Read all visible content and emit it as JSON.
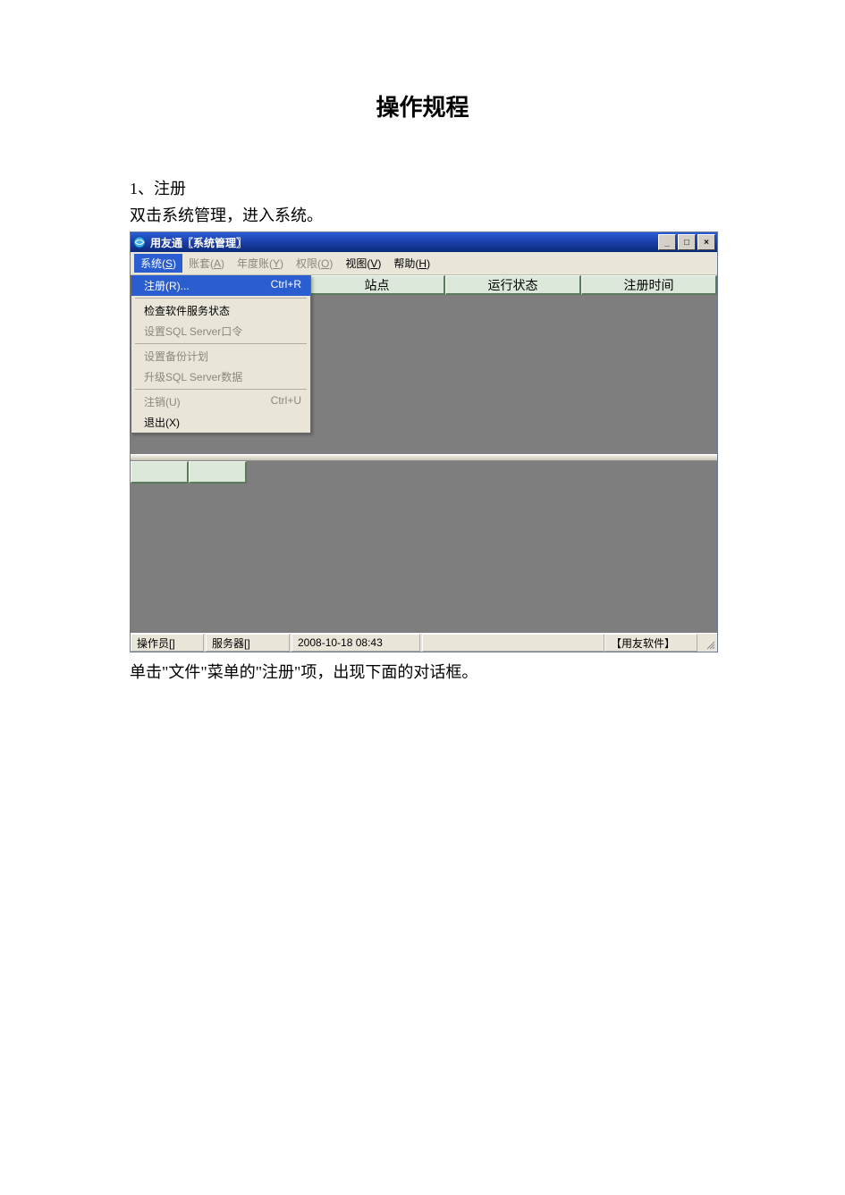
{
  "document": {
    "title": "操作规程",
    "section_number": "1、注册",
    "section_instruction": "双击系统管理，进入系统。",
    "caption_after": "单击\"文件\"菜单的\"注册\"项，出现下面的对话框。"
  },
  "window": {
    "title": "用友通〖系统管理〗",
    "menubar": [
      {
        "label": "系统",
        "mnemonic": "S",
        "disabled": false,
        "open": true
      },
      {
        "label": "账套",
        "mnemonic": "A",
        "disabled": true
      },
      {
        "label": "年度账",
        "mnemonic": "Y",
        "disabled": true
      },
      {
        "label": "权限",
        "mnemonic": "O",
        "disabled": true
      },
      {
        "label": "视图",
        "mnemonic": "V",
        "disabled": false
      },
      {
        "label": "帮助",
        "mnemonic": "H",
        "disabled": false
      }
    ],
    "system_menu": [
      {
        "label": "注册(R)...",
        "shortcut": "Ctrl+R",
        "disabled": false,
        "highlight": true
      },
      {
        "separator": true
      },
      {
        "label": "检查软件服务状态",
        "disabled": false
      },
      {
        "label": "设置SQL Server口令",
        "disabled": true
      },
      {
        "separator": true
      },
      {
        "label": "设置备份计划",
        "disabled": true
      },
      {
        "label": "升级SQL Server数据",
        "disabled": true
      },
      {
        "separator": true
      },
      {
        "label": "注销(U)",
        "shortcut": "Ctrl+U",
        "disabled": true
      },
      {
        "label": "退出(X)",
        "disabled": false
      }
    ],
    "column_headers": [
      "站点",
      "运行状态",
      "注册时间"
    ],
    "status": {
      "operator": "操作员[]",
      "server": "服务器[]",
      "datetime": "2008-10-18 08:43",
      "brand": "【用友软件】"
    },
    "window_controls": {
      "minimize": "_",
      "maximize": "□",
      "close": "×"
    }
  }
}
